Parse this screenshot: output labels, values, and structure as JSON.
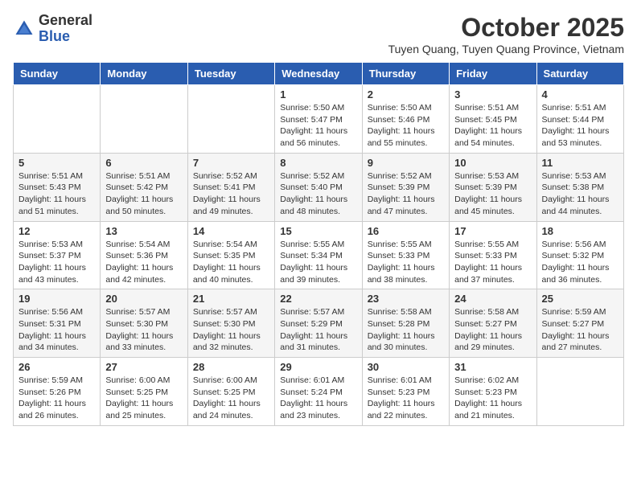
{
  "logo": {
    "line1": "General",
    "line2": "Blue"
  },
  "title": "October 2025",
  "location": "Tuyen Quang, Tuyen Quang Province, Vietnam",
  "headers": [
    "Sunday",
    "Monday",
    "Tuesday",
    "Wednesday",
    "Thursday",
    "Friday",
    "Saturday"
  ],
  "weeks": [
    [
      {
        "day": "",
        "info": ""
      },
      {
        "day": "",
        "info": ""
      },
      {
        "day": "",
        "info": ""
      },
      {
        "day": "1",
        "info": "Sunrise: 5:50 AM\nSunset: 5:47 PM\nDaylight: 11 hours\nand 56 minutes."
      },
      {
        "day": "2",
        "info": "Sunrise: 5:50 AM\nSunset: 5:46 PM\nDaylight: 11 hours\nand 55 minutes."
      },
      {
        "day": "3",
        "info": "Sunrise: 5:51 AM\nSunset: 5:45 PM\nDaylight: 11 hours\nand 54 minutes."
      },
      {
        "day": "4",
        "info": "Sunrise: 5:51 AM\nSunset: 5:44 PM\nDaylight: 11 hours\nand 53 minutes."
      }
    ],
    [
      {
        "day": "5",
        "info": "Sunrise: 5:51 AM\nSunset: 5:43 PM\nDaylight: 11 hours\nand 51 minutes."
      },
      {
        "day": "6",
        "info": "Sunrise: 5:51 AM\nSunset: 5:42 PM\nDaylight: 11 hours\nand 50 minutes."
      },
      {
        "day": "7",
        "info": "Sunrise: 5:52 AM\nSunset: 5:41 PM\nDaylight: 11 hours\nand 49 minutes."
      },
      {
        "day": "8",
        "info": "Sunrise: 5:52 AM\nSunset: 5:40 PM\nDaylight: 11 hours\nand 48 minutes."
      },
      {
        "day": "9",
        "info": "Sunrise: 5:52 AM\nSunset: 5:39 PM\nDaylight: 11 hours\nand 47 minutes."
      },
      {
        "day": "10",
        "info": "Sunrise: 5:53 AM\nSunset: 5:39 PM\nDaylight: 11 hours\nand 45 minutes."
      },
      {
        "day": "11",
        "info": "Sunrise: 5:53 AM\nSunset: 5:38 PM\nDaylight: 11 hours\nand 44 minutes."
      }
    ],
    [
      {
        "day": "12",
        "info": "Sunrise: 5:53 AM\nSunset: 5:37 PM\nDaylight: 11 hours\nand 43 minutes."
      },
      {
        "day": "13",
        "info": "Sunrise: 5:54 AM\nSunset: 5:36 PM\nDaylight: 11 hours\nand 42 minutes."
      },
      {
        "day": "14",
        "info": "Sunrise: 5:54 AM\nSunset: 5:35 PM\nDaylight: 11 hours\nand 40 minutes."
      },
      {
        "day": "15",
        "info": "Sunrise: 5:55 AM\nSunset: 5:34 PM\nDaylight: 11 hours\nand 39 minutes."
      },
      {
        "day": "16",
        "info": "Sunrise: 5:55 AM\nSunset: 5:33 PM\nDaylight: 11 hours\nand 38 minutes."
      },
      {
        "day": "17",
        "info": "Sunrise: 5:55 AM\nSunset: 5:33 PM\nDaylight: 11 hours\nand 37 minutes."
      },
      {
        "day": "18",
        "info": "Sunrise: 5:56 AM\nSunset: 5:32 PM\nDaylight: 11 hours\nand 36 minutes."
      }
    ],
    [
      {
        "day": "19",
        "info": "Sunrise: 5:56 AM\nSunset: 5:31 PM\nDaylight: 11 hours\nand 34 minutes."
      },
      {
        "day": "20",
        "info": "Sunrise: 5:57 AM\nSunset: 5:30 PM\nDaylight: 11 hours\nand 33 minutes."
      },
      {
        "day": "21",
        "info": "Sunrise: 5:57 AM\nSunset: 5:30 PM\nDaylight: 11 hours\nand 32 minutes."
      },
      {
        "day": "22",
        "info": "Sunrise: 5:57 AM\nSunset: 5:29 PM\nDaylight: 11 hours\nand 31 minutes."
      },
      {
        "day": "23",
        "info": "Sunrise: 5:58 AM\nSunset: 5:28 PM\nDaylight: 11 hours\nand 30 minutes."
      },
      {
        "day": "24",
        "info": "Sunrise: 5:58 AM\nSunset: 5:27 PM\nDaylight: 11 hours\nand 29 minutes."
      },
      {
        "day": "25",
        "info": "Sunrise: 5:59 AM\nSunset: 5:27 PM\nDaylight: 11 hours\nand 27 minutes."
      }
    ],
    [
      {
        "day": "26",
        "info": "Sunrise: 5:59 AM\nSunset: 5:26 PM\nDaylight: 11 hours\nand 26 minutes."
      },
      {
        "day": "27",
        "info": "Sunrise: 6:00 AM\nSunset: 5:25 PM\nDaylight: 11 hours\nand 25 minutes."
      },
      {
        "day": "28",
        "info": "Sunrise: 6:00 AM\nSunset: 5:25 PM\nDaylight: 11 hours\nand 24 minutes."
      },
      {
        "day": "29",
        "info": "Sunrise: 6:01 AM\nSunset: 5:24 PM\nDaylight: 11 hours\nand 23 minutes."
      },
      {
        "day": "30",
        "info": "Sunrise: 6:01 AM\nSunset: 5:23 PM\nDaylight: 11 hours\nand 22 minutes."
      },
      {
        "day": "31",
        "info": "Sunrise: 6:02 AM\nSunset: 5:23 PM\nDaylight: 11 hours\nand 21 minutes."
      },
      {
        "day": "",
        "info": ""
      }
    ]
  ]
}
